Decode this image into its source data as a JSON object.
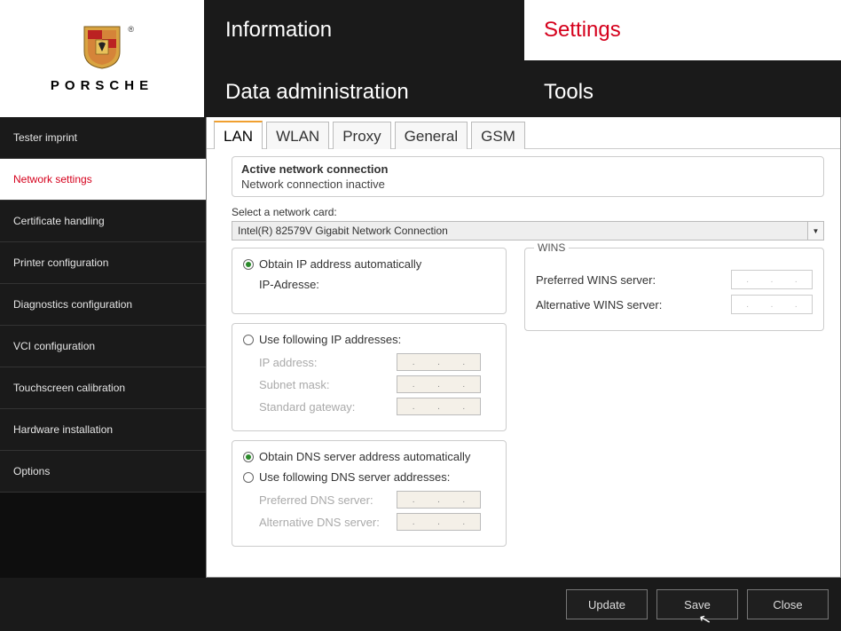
{
  "brand": {
    "wordmark": "PORSCHE"
  },
  "topnav": {
    "information": "Information",
    "settings": "Settings",
    "data_admin": "Data administration",
    "tools": "Tools"
  },
  "sidebar": {
    "items": [
      "Tester imprint",
      "Network settings",
      "Certificate handling",
      "Printer configuration",
      "Diagnostics configuration",
      "VCI configuration",
      "Touchscreen calibration",
      "Hardware installation",
      "Options"
    ],
    "active_index": 1
  },
  "tabs": {
    "items": [
      "LAN",
      "WLAN",
      "Proxy",
      "General",
      "GSM"
    ],
    "active_index": 0
  },
  "active_connection": {
    "header": "Active network connection",
    "status": "Network connection inactive"
  },
  "network_card": {
    "label": "Select a network card:",
    "selected": "Intel(R) 82579V Gigabit Network Connection"
  },
  "ip_section": {
    "auto_label": "Obtain IP address automatically",
    "manual_label": "Use following IP addresses:",
    "ip_adresse_label": "IP-Adresse:",
    "ip_address_label": "IP address:",
    "subnet_label": "Subnet mask:",
    "gateway_label": "Standard gateway:",
    "mode": "auto"
  },
  "dns_section": {
    "auto_label": "Obtain DNS server address automatically",
    "manual_label": "Use following DNS server addresses:",
    "preferred_label": "Preferred DNS server:",
    "alternative_label": "Alternative DNS server:",
    "mode": "auto"
  },
  "wins": {
    "legend": "WINS",
    "preferred_label": "Preferred WINS server:",
    "alternative_label": "Alternative WINS server:"
  },
  "footer": {
    "update": "Update",
    "save": "Save",
    "close": "Close"
  }
}
